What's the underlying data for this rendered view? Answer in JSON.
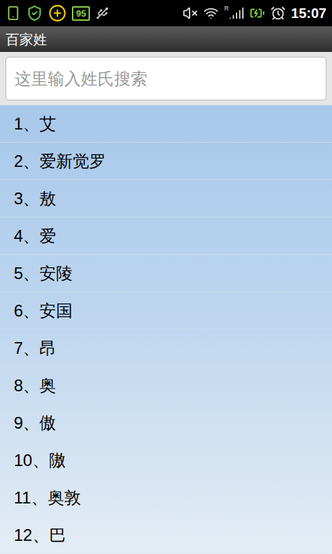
{
  "status_bar": {
    "battery_badge": "95",
    "signal_flag": "R",
    "time": "15:07",
    "muted": true,
    "battery_charging": true
  },
  "window": {
    "title": "百家姓"
  },
  "search": {
    "placeholder": "这里输入姓氏搜索"
  },
  "list": [
    {
      "label": "1、艾"
    },
    {
      "label": "2、爱新觉罗"
    },
    {
      "label": "3、敖"
    },
    {
      "label": "4、爱"
    },
    {
      "label": "5、安陵"
    },
    {
      "label": "6、安国"
    },
    {
      "label": "7、昂"
    },
    {
      "label": "8、奥"
    },
    {
      "label": "9、傲"
    },
    {
      "label": "10、隞"
    },
    {
      "label": "11、奥敦"
    },
    {
      "label": "12、巴"
    }
  ]
}
